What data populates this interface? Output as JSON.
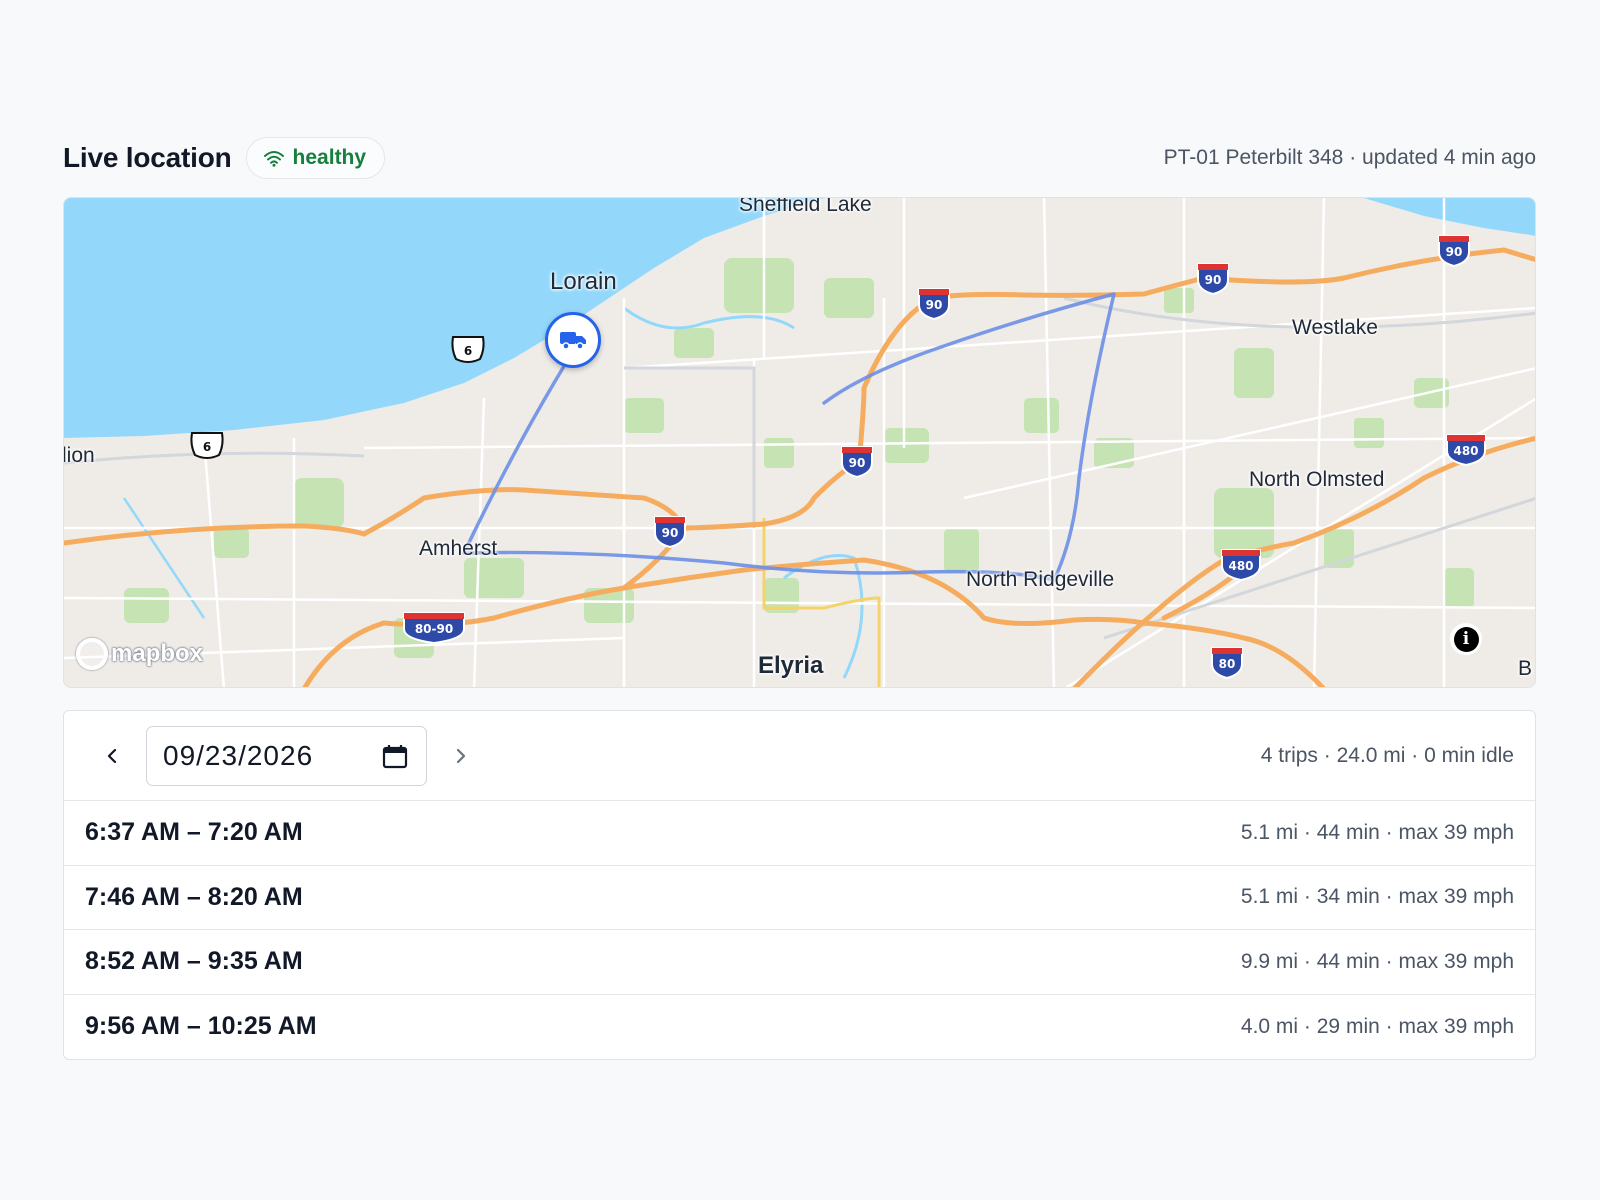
{
  "header": {
    "title": "Live location",
    "status_label": "healthy",
    "vehicle_meta": "PT-01 Peterbilt 348 · updated 4 min ago"
  },
  "map": {
    "cities": {
      "sheffield_lake": "Sheffield Lake",
      "lorain": "Lorain",
      "westlake": "Westlake",
      "lion": "lion",
      "north_olmsted": "North Olmsted",
      "amherst": "Amherst",
      "north_ridgeville": "North Ridgeville",
      "elyria": "Elyria",
      "edge_b": "B"
    },
    "shields": {
      "i90": "90",
      "i480": "480",
      "i80": "80",
      "i80_90": "80-90",
      "us6": "6"
    },
    "attribution": "mapbox",
    "info_glyph": "i",
    "marker_icon": "truck-icon",
    "colors": {
      "water": "#93d8fb",
      "land": "#efece8",
      "park": "#c5e3b3",
      "highway": "#f6ac5f",
      "route": "#6b8fe6",
      "marker": "#2563eb"
    }
  },
  "trips": {
    "date_value": "09/23/2026",
    "summary": "4 trips · 24.0 mi · 0 min idle",
    "items": [
      {
        "time": "6:37 AM – 7:20 AM",
        "stats": "5.1 mi · 44 min · max 39 mph"
      },
      {
        "time": "7:46 AM – 8:20 AM",
        "stats": "5.1 mi · 34 min · max 39 mph"
      },
      {
        "time": "8:52 AM – 9:35 AM",
        "stats": "9.9 mi · 44 min · max 39 mph"
      },
      {
        "time": "9:56 AM – 10:25 AM",
        "stats": "4.0 mi · 29 min · max 39 mph"
      }
    ]
  },
  "colors": {
    "healthy": "#16803c",
    "accent": "#2563eb"
  }
}
